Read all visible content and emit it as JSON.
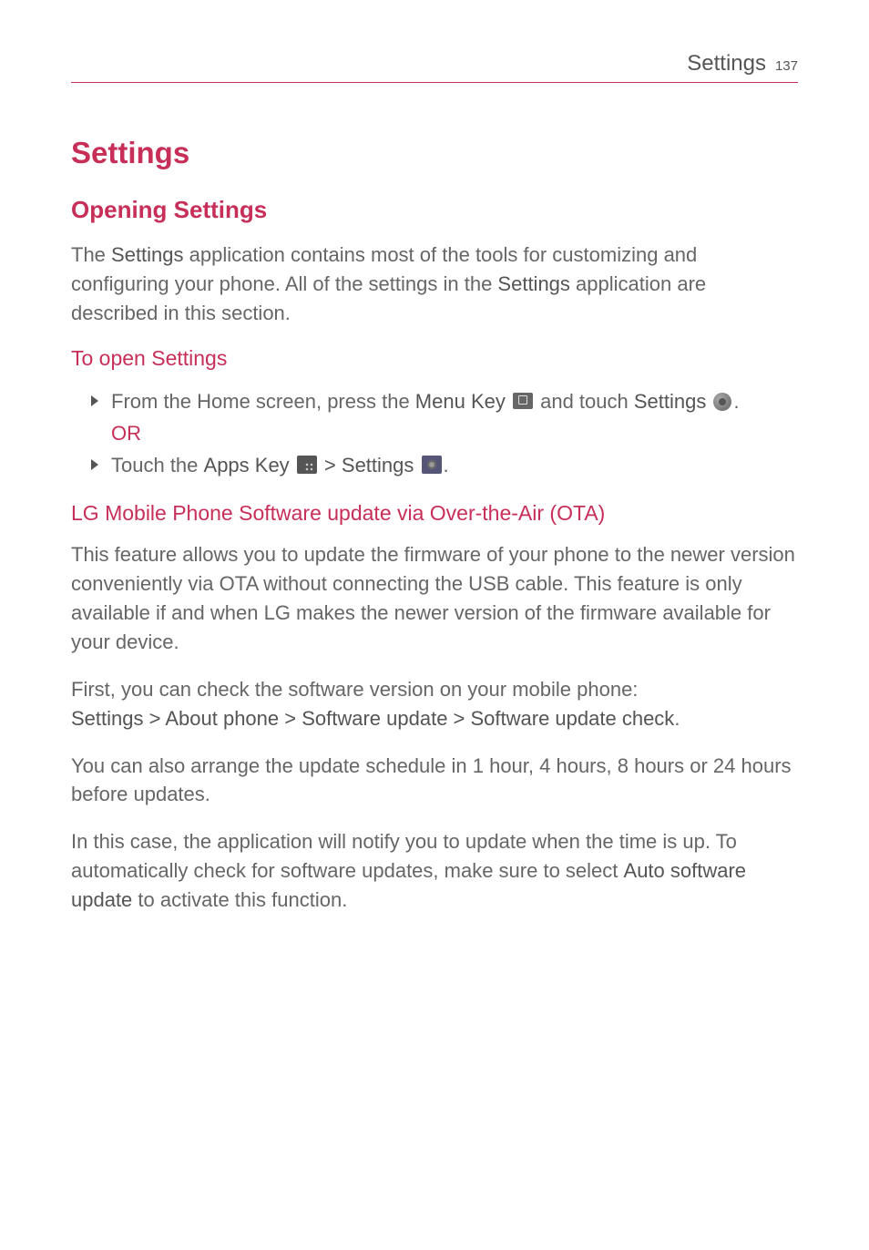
{
  "header": {
    "title": "Settings",
    "page": "137"
  },
  "content": {
    "h1": "Settings",
    "h2": "Opening Settings",
    "intro": {
      "p1_a": "The ",
      "p1_b": "Settings",
      "p1_c": " application contains most of the tools for customizing and configuring your phone. All of the settings in the ",
      "p1_d": "Settings",
      "p1_e": " application are described in this section."
    },
    "section1": {
      "h3": "To open Settings",
      "step1": {
        "a": "From the Home screen, press the ",
        "b": "Menu Key",
        "c": " and touch ",
        "d": "Settings",
        "e": "."
      },
      "or": "OR",
      "step2": {
        "a": "Touch the ",
        "b": "Apps Key",
        "c": " > ",
        "d": "Settings",
        "e": "."
      }
    },
    "section2": {
      "h3": "LG Mobile Phone Software update via Over-the-Air (OTA)",
      "p1": "This feature allows you to update the firmware of your phone to the newer version conveniently via OTA without connecting the USB cable. This feature is only available if and when LG makes the newer version of the firmware available for your device.",
      "p2_a": "First, you can check the software version on your mobile phone: ",
      "p2_b": "Settings > About phone > Software update > Software update check",
      "p2_c": ".",
      "p3": "You can also arrange the update schedule in 1 hour, 4 hours, 8 hours or 24 hours before updates.",
      "p4_a": "In this case, the application will notify you to update when the time is up. To automatically check for software updates, make sure to select ",
      "p4_b": "Auto software update",
      "p4_c": " to activate this function."
    }
  }
}
